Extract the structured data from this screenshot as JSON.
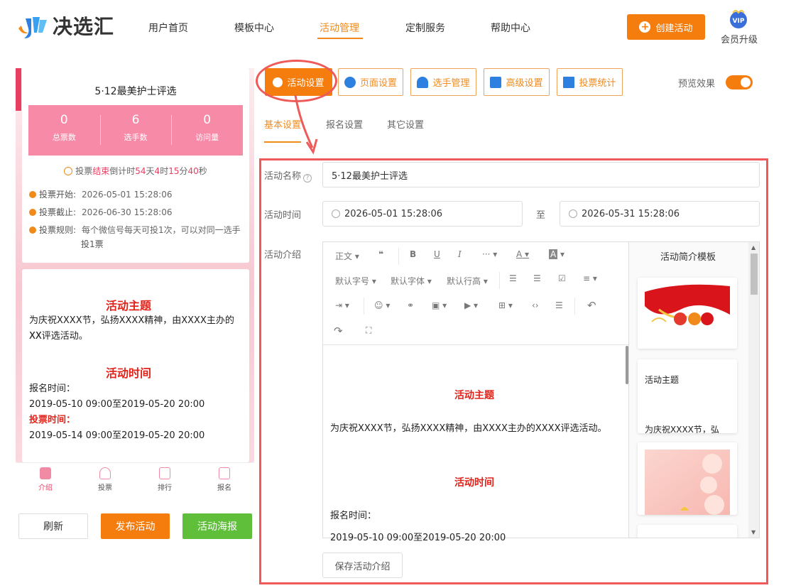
{
  "brand": {
    "name": "决选汇"
  },
  "nav": {
    "items": [
      "用户首页",
      "模板中心",
      "活动管理",
      "定制服务",
      "帮助中心"
    ],
    "active": "活动管理",
    "create_button": "创建活动",
    "vip_badge": "VIP",
    "vip_label": "会员升级"
  },
  "colors": {
    "accent": "#f57d0e",
    "pink": "#f78ba7",
    "highlight": "#ee5a5a",
    "red_text": "#e2231a",
    "green": "#5fbf3a"
  },
  "preview": {
    "title": "5·12最美护士评选",
    "stats": [
      {
        "value": "0",
        "label": "总票数"
      },
      {
        "value": "6",
        "label": "选手数"
      },
      {
        "value": "0",
        "label": "访问量"
      }
    ],
    "countdown": {
      "prefix": "投票",
      "status": "结束",
      "mid": "倒计时",
      "days": "54",
      "d_unit": "天",
      "hours": "4",
      "h_unit": "时",
      "minutes": "15",
      "m_unit": "分",
      "seconds": "40",
      "s_unit": "秒"
    },
    "info": [
      {
        "label": "投票开始:",
        "value": "2026-05-01 15:28:06"
      },
      {
        "label": "投票截止:",
        "value": "2026-06-30 15:28:06"
      },
      {
        "label": "投票规则:",
        "value": "每个微信号每天可投1次，可以对同一选手",
        "value2": "投1票"
      }
    ],
    "intro": {
      "h1": "活动主题",
      "p1_line1": "为庆祝XXXX节，弘扬XXXX精神，由XXXX主办的XX",
      "p1_line2": "XX评选活动。",
      "h2": "活动时间",
      "signup_label": "报名时间：",
      "signup_range": "2019-05-10 09:00至2019-05-20 20:00",
      "vote_label": "投票时间：",
      "vote_range": "2019-05-14 09:00至2019-05-20 20:00"
    },
    "tabbar": [
      "介绍",
      "投票",
      "排行",
      "报名"
    ],
    "buttons": {
      "refresh": "刷新",
      "publish": "发布活动",
      "poster": "活动海报"
    }
  },
  "toolbar": {
    "buttons": [
      "活动设置",
      "页面设置",
      "选手管理",
      "高级设置",
      "投票统计"
    ],
    "preview_label": "预览效果",
    "preview_on": true
  },
  "subtabs": [
    "基本设置",
    "报名设置",
    "其它设置"
  ],
  "form": {
    "name_label": "活动名称",
    "name_value": "5·12最美护士评选",
    "time_label": "活动时间",
    "time_start": "2026-05-01 15:28:06",
    "time_sep": "至",
    "time_end": "2026-05-31 15:28:06",
    "intro_label": "活动介绍",
    "save_button": "保存活动介绍"
  },
  "editor": {
    "tools_row1": [
      "正文",
      "❝",
      "B",
      "U",
      "I",
      "···",
      "A",
      "A"
    ],
    "tools_row2": [
      "默认字号",
      "默认字体",
      "默认行高"
    ],
    "content": {
      "h1": "活动主题",
      "p1": "为庆祝XXXX节，弘扬XXXX精神，由XXXX主办的XXXX评选活动。",
      "h2": "活动时间",
      "signup_label": "报名时间：",
      "signup_range": "2019-05-10 09:00至2019-05-20 20:00"
    }
  },
  "templates": {
    "title": "活动简介模板",
    "card2_title": "活动主题",
    "card2_text": "为庆祝XXXX节，弘"
  }
}
